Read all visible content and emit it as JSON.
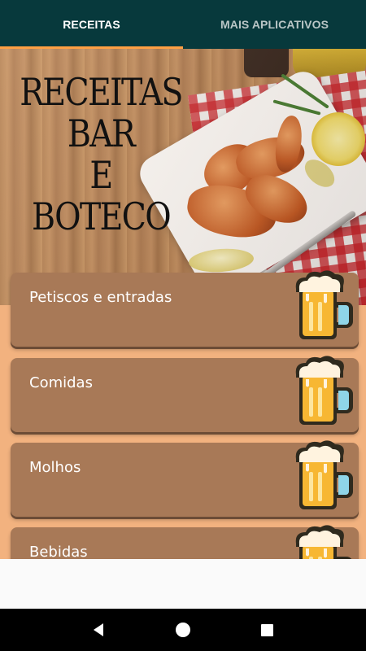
{
  "tabs": [
    {
      "label": "RECEITAS",
      "active": true
    },
    {
      "label": "MAIS APLICATIVOS",
      "active": false
    }
  ],
  "hero": {
    "title_lines": [
      "RECEITAS",
      "BAR",
      "E",
      "BOTECO"
    ]
  },
  "categories": [
    {
      "label": "Petiscos e entradas",
      "icon": "beer-mug-icon"
    },
    {
      "label": "Comidas",
      "icon": "beer-mug-icon"
    },
    {
      "label": "Molhos",
      "icon": "beer-mug-icon"
    },
    {
      "label": "Bebidas",
      "icon": "beer-mug-icon"
    }
  ],
  "navigation": {
    "buttons": [
      "back-icon",
      "home-icon",
      "recents-icon"
    ]
  },
  "colors": {
    "tabbar": "#07393c",
    "tab_indicator": "#ff9f43",
    "card": "#a87957",
    "list_background": "#f2b27f"
  }
}
